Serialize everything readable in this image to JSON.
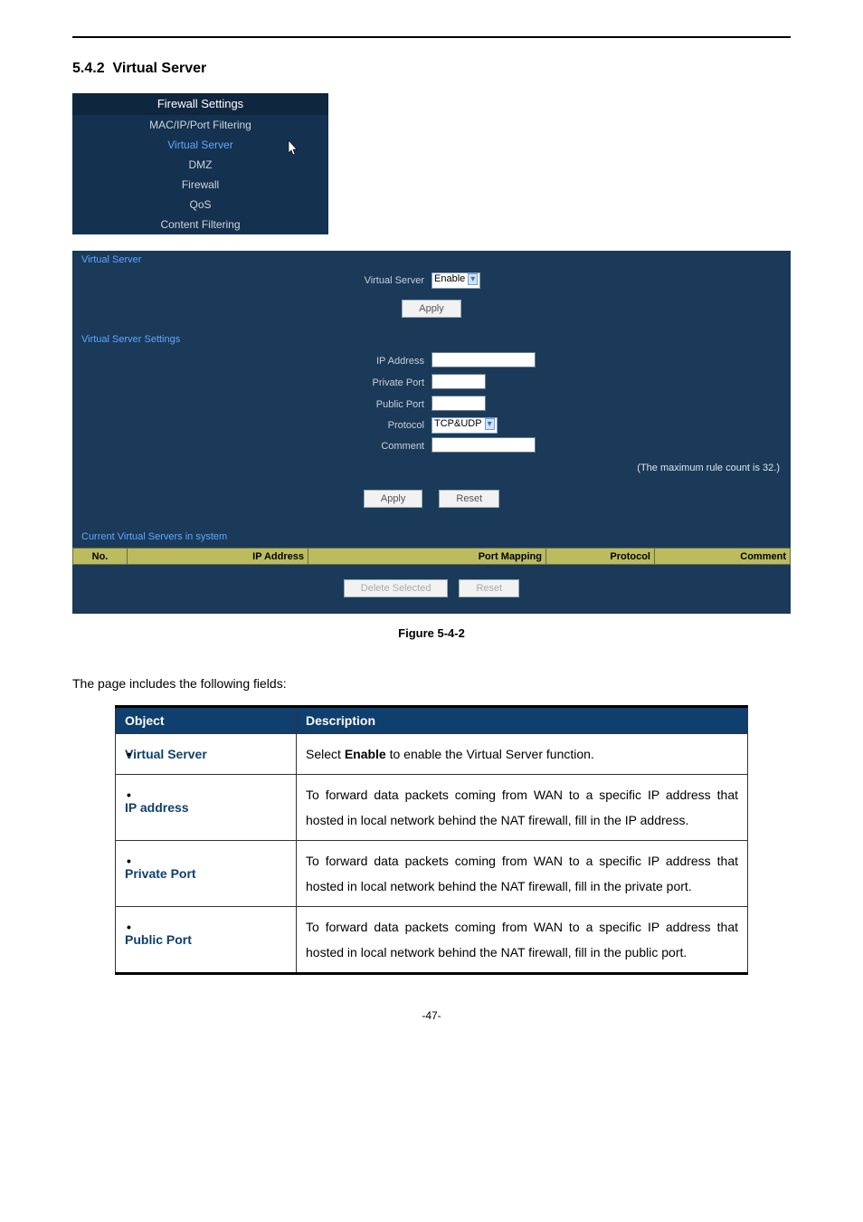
{
  "page": {
    "section_no": "5.4.2",
    "section_title": "Virtual Server",
    "figure_caption": "Figure 5-4-2",
    "intro_line": "The page includes the following fields:",
    "page_number": "-47-"
  },
  "nav": {
    "header": "Firewall Settings",
    "items": [
      {
        "label": "MAC/IP/Port Filtering",
        "selected": false
      },
      {
        "label": "Virtual Server",
        "selected": true
      },
      {
        "label": "DMZ",
        "selected": false
      },
      {
        "label": "Firewall",
        "selected": false
      },
      {
        "label": "QoS",
        "selected": false
      },
      {
        "label": "Content Filtering",
        "selected": false
      }
    ]
  },
  "vs_panel": {
    "title1": "Virtual Server",
    "row_vs_label": "Virtual Server",
    "row_vs_value": "Enable",
    "apply": "Apply",
    "title2": "Virtual Server Settings",
    "ip_label": "IP Address",
    "priv_label": "Private Port",
    "pub_label": "Public Port",
    "proto_label": "Protocol",
    "proto_value": "TCP&UDP",
    "comment_label": "Comment",
    "max_note": "(The maximum rule count is 32.)",
    "apply2": "Apply",
    "reset": "Reset",
    "title3": "Current Virtual Servers in system",
    "th_no": "No.",
    "th_ip": "IP Address",
    "th_port": "Port Mapping",
    "th_proto": "Protocol",
    "th_comment": "Comment",
    "delete_btn": "Delete Selected",
    "reset_btn": "Reset"
  },
  "desc_table": {
    "h_obj": "Object",
    "h_desc": "Description",
    "rows": [
      {
        "obj": "Virtual Server",
        "desc": "Select <b>Enable</b> to enable the Virtual Server function."
      },
      {
        "obj": "IP address",
        "desc": "To forward data packets coming from WAN to a specific IP address that hosted in local network behind the NAT firewall, fill in the IP address."
      },
      {
        "obj": "Private Port",
        "desc": "To forward data packets coming from WAN to a specific IP address that hosted in local network behind the NAT firewall, fill in the private port."
      },
      {
        "obj": "Public Port",
        "desc": "To forward data packets coming from WAN to a specific IP address that hosted in local network behind the NAT firewall, fill in the public port."
      }
    ]
  }
}
